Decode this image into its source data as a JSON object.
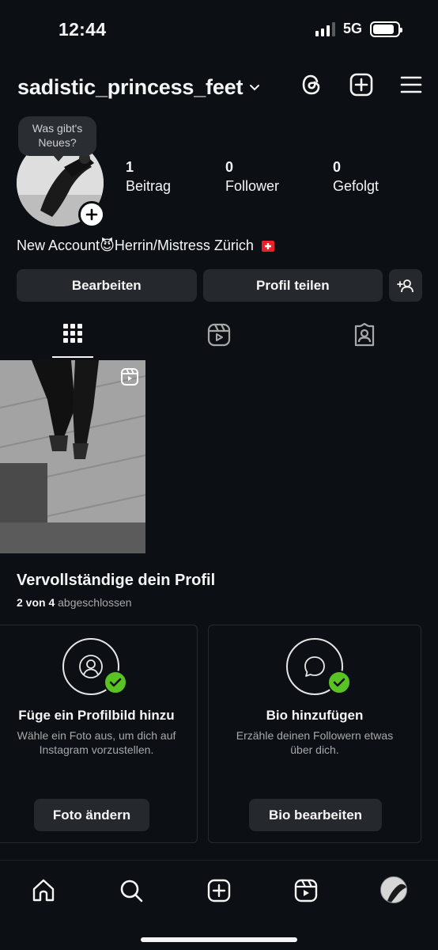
{
  "status_bar": {
    "time": "12:44",
    "network": "5G"
  },
  "header": {
    "username": "sadistic_princess_feet",
    "icons": [
      "chevron-down-icon",
      "threads-icon",
      "create-icon",
      "menu-icon"
    ]
  },
  "profile": {
    "note_bubble": "Was gibt's\nNeues?",
    "stats": [
      {
        "value": "1",
        "label": "Beitrag"
      },
      {
        "value": "0",
        "label": "Follower"
      },
      {
        "value": "0",
        "label": "Gefolgt"
      }
    ],
    "bio": {
      "part1": "New Account",
      "emoji": "😈",
      "part2": "Herrin/Mistress Zürich"
    },
    "buttons": {
      "edit": "Bearbeiten",
      "share": "Profil teilen"
    }
  },
  "tabs": [
    "grid-icon",
    "reels-icon",
    "tagged-icon"
  ],
  "complete_profile": {
    "title": "Vervollständige dein Profil",
    "progress_done": "2 von 4",
    "progress_label": "abgeschlossen",
    "cards": [
      {
        "title": "Füge ein Profilbild hinzu",
        "description": "Wähle ein Foto aus, um dich auf\nInstagram vorzustellen.",
        "button": "Foto ändern"
      },
      {
        "title": "Bio hinzufügen",
        "description": "Erzähle deinen Followern etwas\nüber dich.",
        "button": "Bio bearbeiten"
      }
    ]
  },
  "bottom_nav": [
    "home-icon",
    "search-icon",
    "create-icon",
    "reels-icon",
    "profile-avatar"
  ]
}
